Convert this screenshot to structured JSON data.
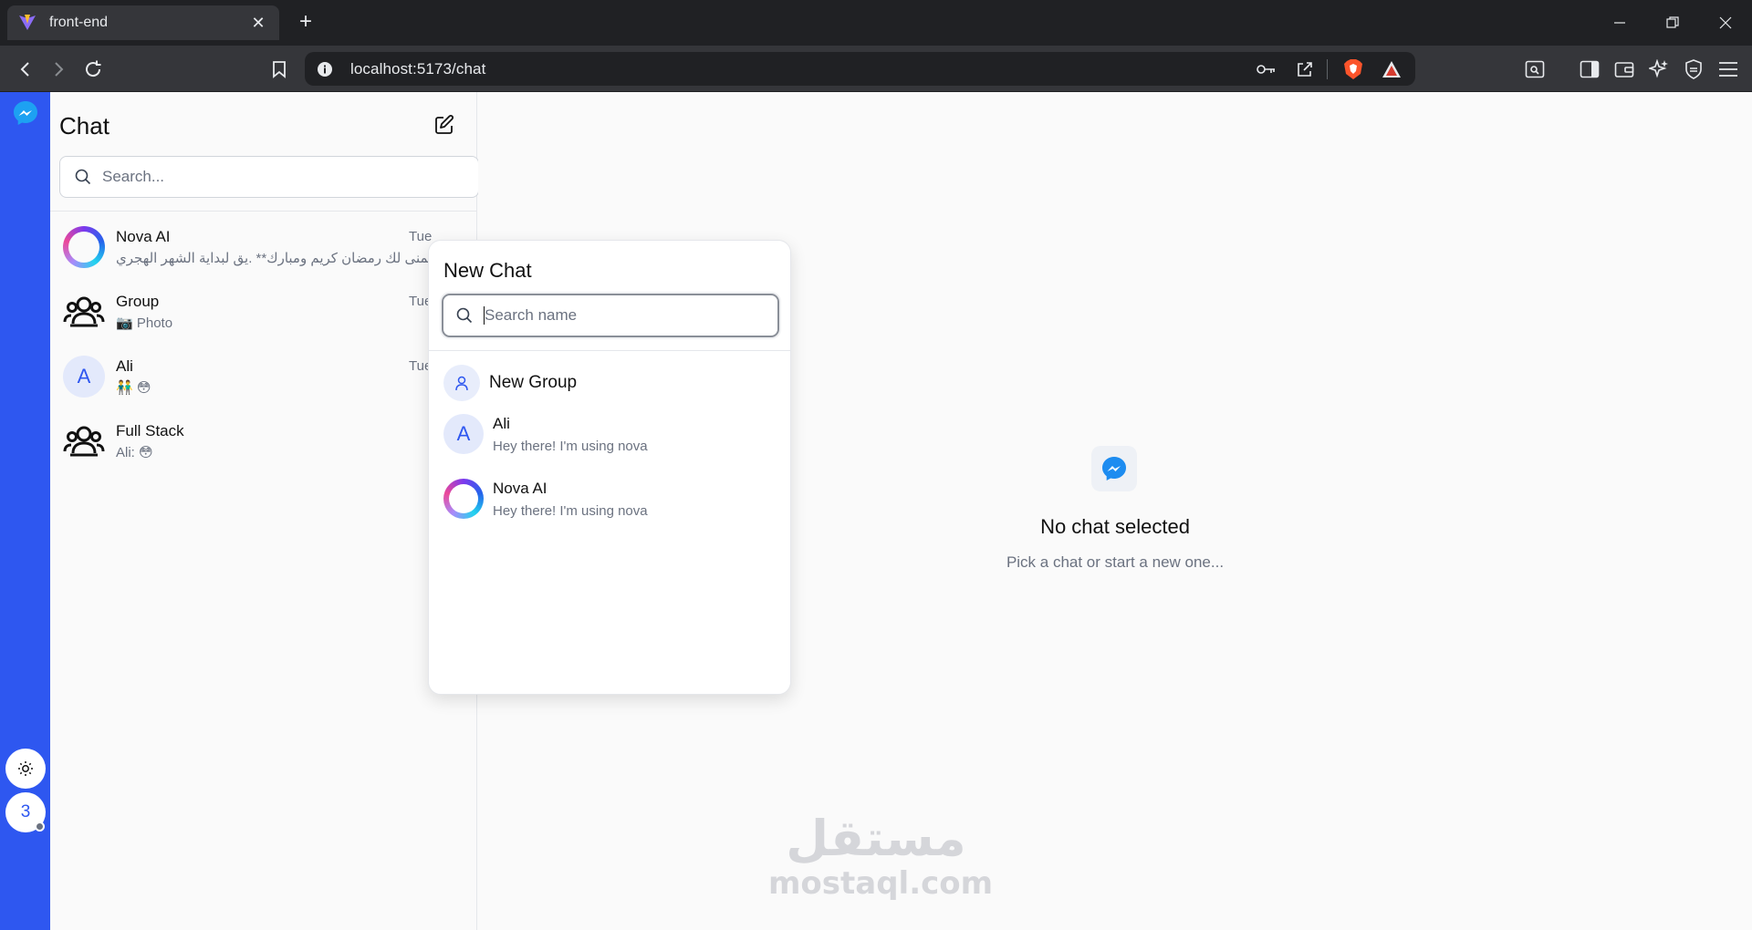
{
  "browser": {
    "tab_title": "front-end",
    "url": "localhost:5173/chat"
  },
  "rail": {
    "avatar_letter": "3"
  },
  "sidebar": {
    "title": "Chat",
    "search_placeholder": "Search...",
    "chats": [
      {
        "name": "Nova AI",
        "preview": "أتمنى لك رمضان كريم ومبارك** .يق لبداية الشهر الهجري",
        "time": "Tue",
        "avatar": "ring"
      },
      {
        "name": "Group",
        "preview": "📷 Photo",
        "time": "Tue",
        "avatar": "group-icon"
      },
      {
        "name": "Ali",
        "preview": "👬 😳",
        "time": "Tue",
        "avatar": "A"
      },
      {
        "name": "Full Stack",
        "preview": "Ali: 😳",
        "time": "",
        "avatar": "group-icon"
      }
    ]
  },
  "main": {
    "empty_title": "No chat selected",
    "empty_subtitle": "Pick a chat or start a new one..."
  },
  "popover": {
    "title": "New Chat",
    "search_placeholder": "Search name",
    "new_group_label": "New Group",
    "contacts": [
      {
        "name": "Ali",
        "status": "Hey there! I'm using nova",
        "avatar": "A"
      },
      {
        "name": "Nova AI",
        "status": "Hey there! I'm using nova",
        "avatar": "ring"
      }
    ]
  },
  "watermark": {
    "arabic": "مستقل",
    "latin": "mostaql.com"
  },
  "colors": {
    "rail": "#2e57f0",
    "chrome_dark": "#202124",
    "chrome_toolbar": "#35363a"
  }
}
